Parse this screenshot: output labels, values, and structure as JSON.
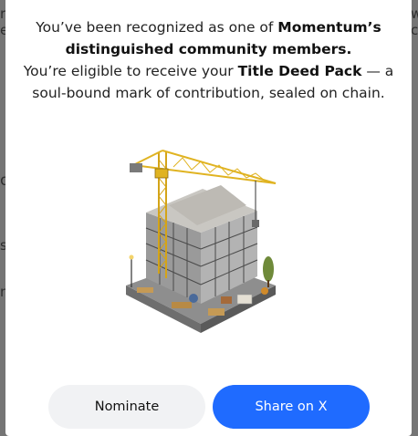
{
  "background": {
    "fragments": [
      "r",
      "ei",
      "o",
      "se",
      "m",
      "w",
      "c"
    ]
  },
  "modal": {
    "line1_pre": "You’ve been recognized as one of ",
    "line1_bold": "Momentum’s",
    "line2_bold": "distinguished community members.",
    "line3_pre": "You’re eligible to receive your ",
    "line3_bold": "Title Deed Pack",
    "line3_post": " — a",
    "line4": "soul-bound mark of contribution, sealed on chain."
  },
  "illustration": {
    "icon": "construction-building-illustration"
  },
  "buttons": {
    "nominate_label": "Nominate",
    "share_label": "Share on X"
  },
  "colors": {
    "accent": "#1f6bff",
    "secondary_button": "#f1f2f4",
    "crane": "#e0b321"
  }
}
